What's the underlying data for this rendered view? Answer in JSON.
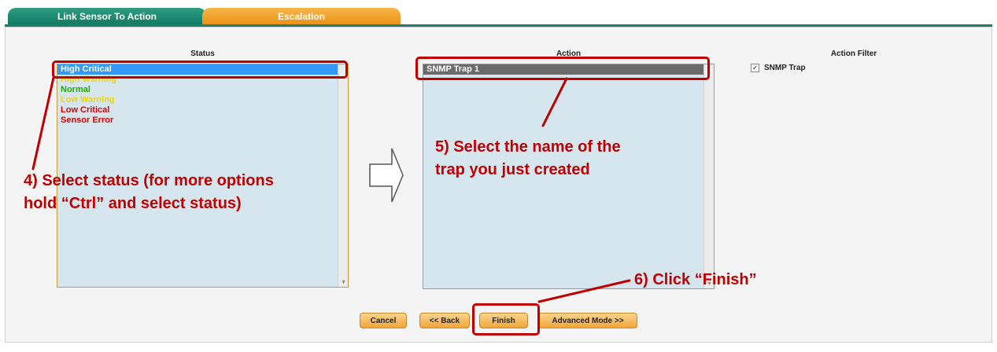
{
  "tabs": [
    {
      "label": "Link Sensor To Action"
    },
    {
      "label": "Escalation"
    }
  ],
  "status": {
    "label": "Status",
    "items": [
      {
        "label": "High Critical",
        "color": "#ffffff",
        "selected": true
      },
      {
        "label": "High Warning",
        "color": "#f5d300"
      },
      {
        "label": "Normal",
        "color": "#22aa00"
      },
      {
        "label": "Low Warning",
        "color": "#f5d300"
      },
      {
        "label": "Low Critical",
        "color": "#e00000"
      },
      {
        "label": "Sensor Error",
        "color": "#e00000"
      }
    ]
  },
  "action": {
    "label": "Action",
    "items": [
      {
        "label": "SNMP Trap 1",
        "selected": true
      }
    ]
  },
  "action_filter": {
    "label": "Action Filter",
    "checkbox_label": "SNMP Trap",
    "checked": true
  },
  "buttons": {
    "cancel": "Cancel",
    "back": "<< Back",
    "finish": "Finish",
    "advanced": "Advanced Mode >>"
  },
  "annotations": {
    "step4_line1": "4) Select status (for more options",
    "step4_line2": "hold “Ctrl” and select status)",
    "step5_line1": "5) Select the name of the",
    "step5_line2": "trap you just created",
    "step6": "6) Click “Finish”"
  },
  "colors": {
    "annotation": "#c00000",
    "tab_active": "#ec9116",
    "tab_inactive": "#117a62",
    "list_bg": "#d6e6ef",
    "selection_blue": "#3399ff",
    "selection_gray": "#6b6b6b"
  }
}
